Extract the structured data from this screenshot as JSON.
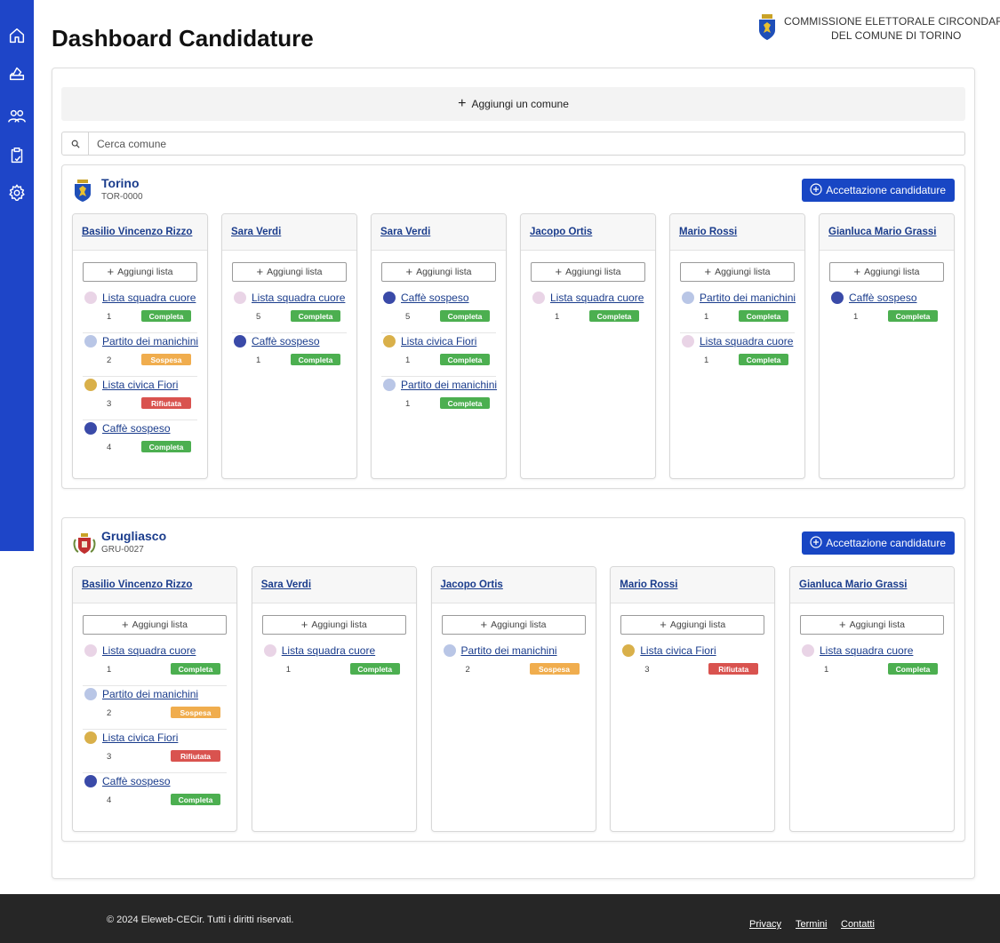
{
  "page": {
    "title": "Dashboard Candidature"
  },
  "header": {
    "org_line1": "COMMISSIONE ELETTORALE CIRCONDARIALE",
    "org_line2": "DEL COMUNE DI TORINO",
    "crest_icon": "city-crest-icon"
  },
  "sidebar": {
    "items": [
      {
        "icon": "home-icon"
      },
      {
        "icon": "ballot-box-icon"
      },
      {
        "icon": "users-icon"
      },
      {
        "icon": "clipboard-check-icon"
      },
      {
        "icon": "gear-icon"
      }
    ]
  },
  "toolbar": {
    "add_comune_label": "Aggiungi un comune",
    "search_placeholder": "Cerca comune"
  },
  "labels": {
    "add_list": "Aggiungi lista",
    "accept_button": "Accettazione candidature"
  },
  "status_colors": {
    "Completa": "#4caf50",
    "Sospesa": "#f0ad4e",
    "Rifiutata": "#d9534f"
  },
  "list_logos": {
    "Lista squadra cuore": {
      "icon": "heart-team-logo-icon",
      "color": "#e9d4e6"
    },
    "Partito dei manichini": {
      "icon": "mannequin-party-logo-icon",
      "color": "#b9c6e6"
    },
    "Lista civica Fiori": {
      "icon": "flower-list-logo-icon",
      "color": "#d9b04a"
    },
    "Caffè sospeso": {
      "icon": "coffee-logo-icon",
      "color": "#3a4aa8"
    }
  },
  "comuni": [
    {
      "name": "Torino",
      "code": "TOR-0000",
      "crest_icon": "torino-crest-icon",
      "candidates": [
        {
          "name": "Basilio Vincenzo Rizzo",
          "lists": [
            {
              "name": "Lista squadra cuore",
              "number": "1",
              "status": "Completa"
            },
            {
              "name": "Partito dei manichini",
              "number": "2",
              "status": "Sospesa"
            },
            {
              "name": "Lista civica Fiori",
              "number": "3",
              "status": "Rifiutata"
            },
            {
              "name": "Caffè sospeso",
              "number": "4",
              "status": "Completa"
            }
          ]
        },
        {
          "name": "Sara Verdi",
          "lists": [
            {
              "name": "Lista squadra cuore",
              "number": "5",
              "status": "Completa"
            },
            {
              "name": "Caffè sospeso",
              "number": "1",
              "status": "Completa"
            }
          ]
        },
        {
          "name": "Sara Verdi",
          "lists": [
            {
              "name": "Caffè sospeso",
              "number": "5",
              "status": "Completa"
            },
            {
              "name": "Lista civica Fiori",
              "number": "1",
              "status": "Completa"
            },
            {
              "name": "Partito dei manichini",
              "number": "1",
              "status": "Completa"
            }
          ]
        },
        {
          "name": "Jacopo Ortis",
          "lists": [
            {
              "name": "Lista squadra cuore",
              "number": "1",
              "status": "Completa"
            }
          ]
        },
        {
          "name": "Mario Rossi",
          "lists": [
            {
              "name": "Partito dei manichini",
              "number": "1",
              "status": "Completa"
            },
            {
              "name": "Lista squadra cuore",
              "number": "1",
              "status": "Completa"
            }
          ]
        },
        {
          "name": "Gianluca Mario Grassi",
          "lists": [
            {
              "name": "Caffè sospeso",
              "number": "1",
              "status": "Completa"
            }
          ]
        }
      ]
    },
    {
      "name": "Grugliasco",
      "code": "GRU-0027",
      "crest_icon": "grugliasco-crest-icon",
      "candidates": [
        {
          "name": "Basilio Vincenzo Rizzo",
          "lists": [
            {
              "name": "Lista squadra cuore",
              "number": "1",
              "status": "Completa"
            },
            {
              "name": "Partito dei manichini",
              "number": "2",
              "status": "Sospesa"
            },
            {
              "name": "Lista civica Fiori",
              "number": "3",
              "status": "Rifiutata"
            },
            {
              "name": "Caffè sospeso",
              "number": "4",
              "status": "Completa"
            }
          ]
        },
        {
          "name": "Sara Verdi",
          "lists": [
            {
              "name": "Lista squadra cuore",
              "number": "1",
              "status": "Completa"
            }
          ]
        },
        {
          "name": "Jacopo Ortis",
          "lists": [
            {
              "name": "Partito dei manichini",
              "number": "2",
              "status": "Sospesa"
            }
          ]
        },
        {
          "name": "Mario Rossi",
          "lists": [
            {
              "name": "Lista civica Fiori",
              "number": "3",
              "status": "Rifiutata"
            }
          ]
        },
        {
          "name": "Gianluca Mario Grassi",
          "lists": [
            {
              "name": "Lista squadra cuore",
              "number": "1",
              "status": "Completa"
            }
          ]
        }
      ]
    }
  ],
  "footer": {
    "copyright": "© 2024 Eleweb-CECir. Tutti i diritti riservati.",
    "links": [
      "Privacy",
      "Termini",
      "Contatti"
    ]
  }
}
